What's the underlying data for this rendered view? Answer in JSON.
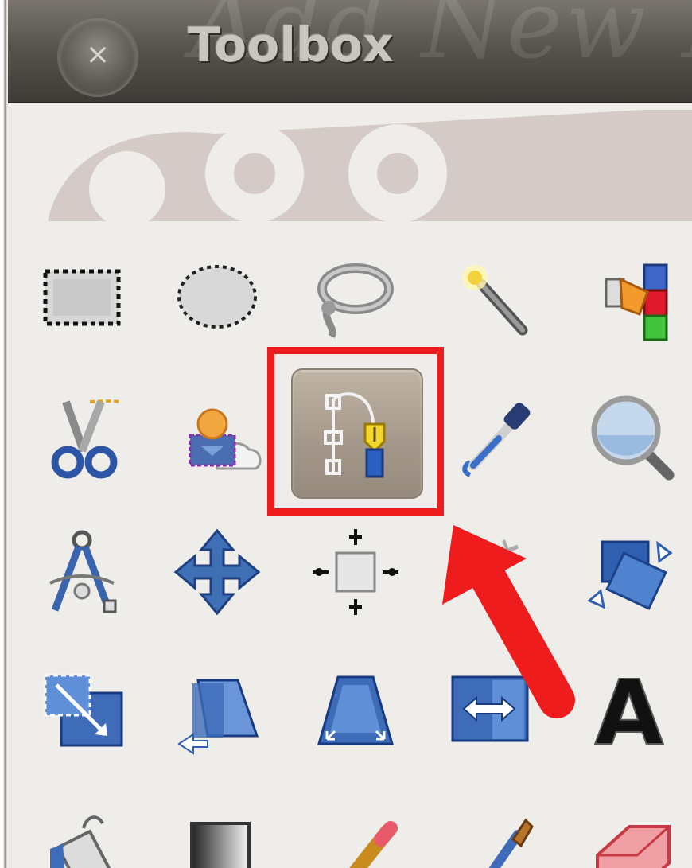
{
  "window": {
    "title": "Toolbox",
    "close_icon": "×",
    "background_ghost_text": "Add New Po"
  },
  "tools": [
    {
      "row": 1,
      "name": "rectangle-select-tool-icon"
    },
    {
      "row": 1,
      "name": "ellipse-select-tool-icon"
    },
    {
      "row": 1,
      "name": "free-select-lasso-tool-icon"
    },
    {
      "row": 1,
      "name": "fuzzy-select-magic-wand-tool-icon"
    },
    {
      "row": 1,
      "name": "select-by-color-tool-icon"
    },
    {
      "row": 2,
      "name": "scissors-select-tool-icon"
    },
    {
      "row": 2,
      "name": "foreground-select-tool-icon"
    },
    {
      "row": 2,
      "name": "paths-tool-icon",
      "selected": true
    },
    {
      "row": 2,
      "name": "color-picker-tool-icon"
    },
    {
      "row": 2,
      "name": "zoom-tool-icon"
    },
    {
      "row": 3,
      "name": "measure-tool-icon"
    },
    {
      "row": 3,
      "name": "move-tool-icon"
    },
    {
      "row": 3,
      "name": "alignment-tool-icon"
    },
    {
      "row": 3,
      "name": "crop-tool-icon"
    },
    {
      "row": 3,
      "name": "rotate-tool-icon"
    },
    {
      "row": 4,
      "name": "scale-tool-icon"
    },
    {
      "row": 4,
      "name": "shear-tool-icon"
    },
    {
      "row": 4,
      "name": "perspective-tool-icon"
    },
    {
      "row": 4,
      "name": "flip-tool-icon"
    },
    {
      "row": 4,
      "name": "text-tool-icon",
      "glyph": "A"
    },
    {
      "row": 5,
      "name": "bucket-fill-tool-icon"
    },
    {
      "row": 5,
      "name": "blend-gradient-tool-icon"
    },
    {
      "row": 5,
      "name": "pencil-tool-icon"
    },
    {
      "row": 5,
      "name": "paintbrush-tool-icon"
    },
    {
      "row": 5,
      "name": "eraser-tool-icon"
    }
  ],
  "annotation": {
    "highlight_color": "#ee1c1c",
    "highlighted_tool": "paths-tool-icon"
  },
  "colors": {
    "titlebar": "#4e4a45",
    "panel": "#efedea",
    "selected_tool_bg": "#a89c8f",
    "tool_blue": "#3f6fb5",
    "arrow_red": "#ee1c1c"
  }
}
